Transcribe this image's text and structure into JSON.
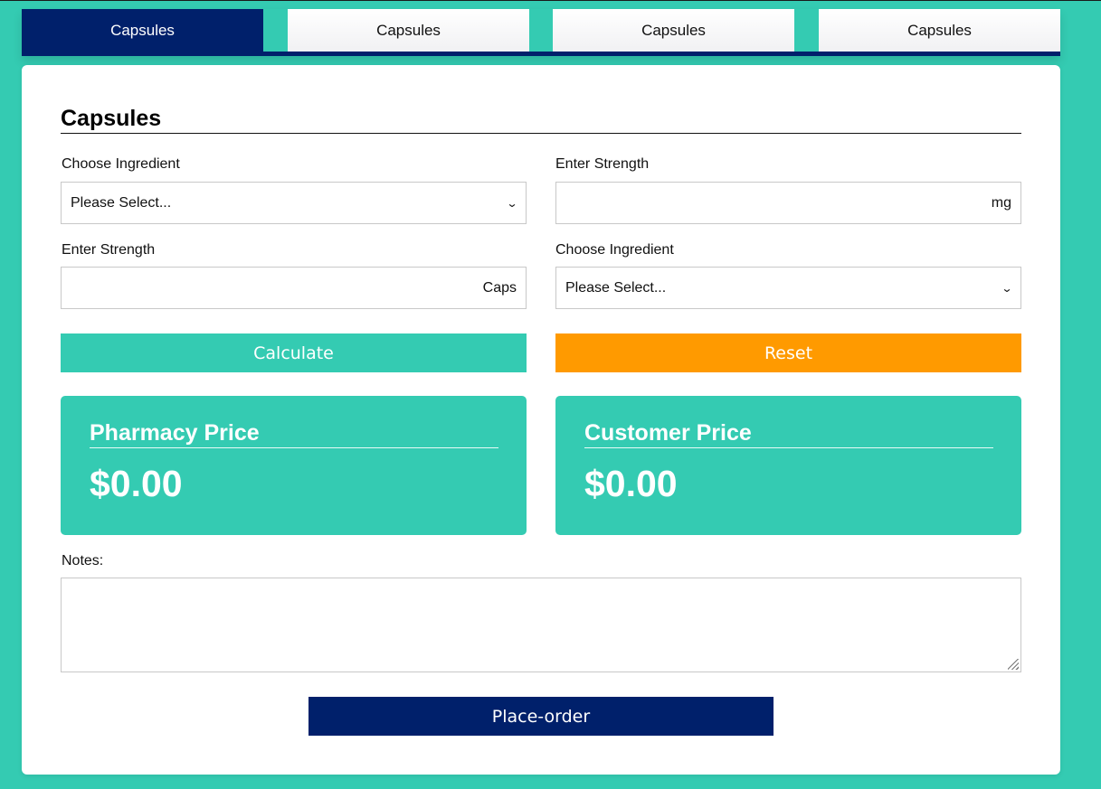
{
  "tabs": [
    {
      "label": "Capsules",
      "active": true
    },
    {
      "label": "Capsules",
      "active": false
    },
    {
      "label": "Capsules",
      "active": false
    },
    {
      "label": "Capsules",
      "active": false
    }
  ],
  "form": {
    "title": "Capsules",
    "ingredient1": {
      "label": "Choose Ingredient",
      "value": "Please Select..."
    },
    "strength1": {
      "label": "Enter Strength",
      "value": "",
      "unit": "mg"
    },
    "strength2": {
      "label": "Enter Strength",
      "value": "",
      "unit": "Caps"
    },
    "ingredient2": {
      "label": "Choose Ingredient",
      "value": "Please Select..."
    },
    "calculate_label": "Calculate",
    "reset_label": "Reset"
  },
  "prices": {
    "pharmacy": {
      "label": "Pharmacy Price",
      "value": "$0.00"
    },
    "customer": {
      "label": "Customer Price",
      "value": "$0.00"
    }
  },
  "notes": {
    "label": "Notes:",
    "value": ""
  },
  "place_order_label": "Place-order",
  "colors": {
    "background": "#34cbb2",
    "navy": "#00206b",
    "reset": "#ff9a00",
    "card": "#ffffff"
  }
}
